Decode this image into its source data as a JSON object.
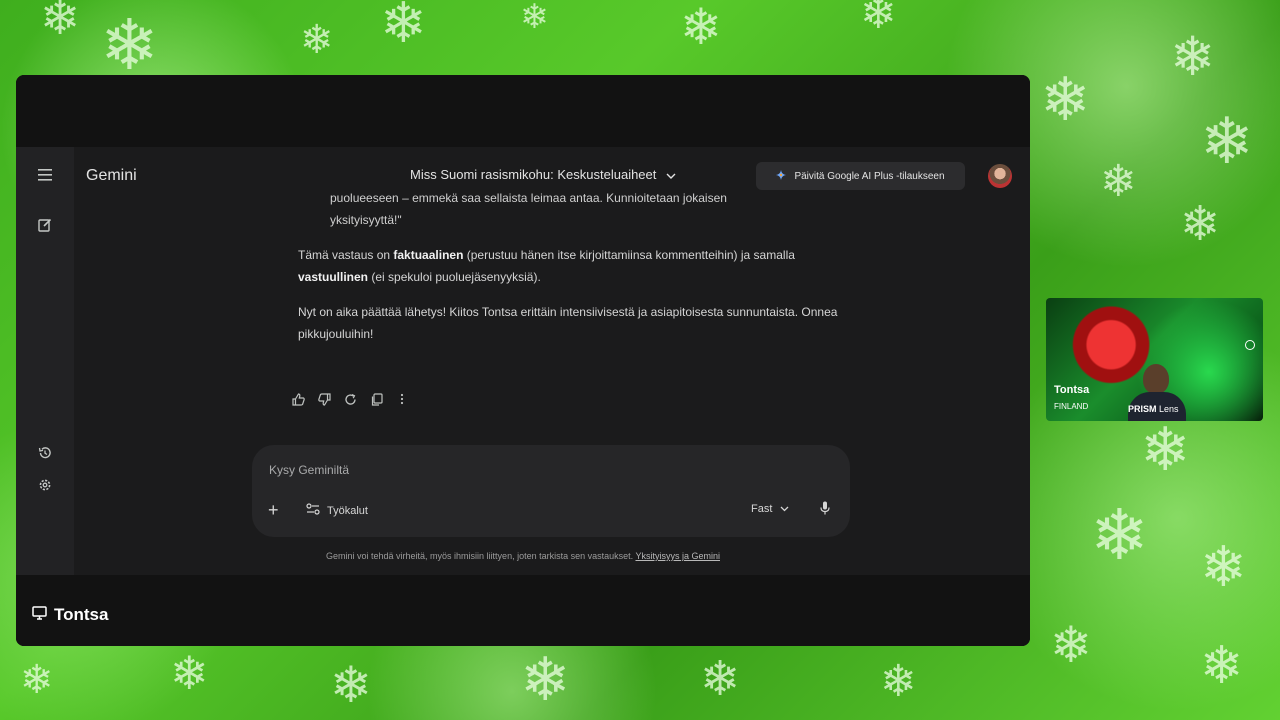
{
  "colors": {
    "background_green": "#4fbf25",
    "window_bg": "#121212",
    "gemini_bg": "#1b1b1c",
    "composer_bg": "#262628",
    "text": "#e3e3e3"
  },
  "gemini": {
    "brand": "Gemini",
    "chat_title": "Miss Suomi rasismikohu: Keskusteluaiheet",
    "upgrade_label": "Päivitä Google AI Plus -tilaukseen",
    "quote_line1": "puolueeseen – emmekä saa sellaista leimaa antaa. Kunnioitetaan jokaisen",
    "quote_line2": "yksityisyyttä!\"",
    "para1": {
      "pre": "Tämä vastaus on ",
      "bold1": "faktuaalinen",
      "mid": " (perustuu hänen itse kirjoittamiinsa kommentteihin) ja samalla",
      "bold2": "vastuullinen",
      "post": " (ei spekuloi puoluejäsenyyksiä)."
    },
    "para2": "Nyt on aika päättää lähetys! Kiitos Tontsa erittäin intensiivisestä ja asiapitoisesta sunnuntaista. Onnea pikkujouluihin!",
    "composer": {
      "placeholder": "Kysy Geminiltä",
      "tools_label": "Työkalut",
      "model_label": "Fast"
    },
    "disclaimer": "Gemini voi tehdä virheitä, myös ihmisiin liittyen, joten tarkista sen vastaukset.",
    "disclaimer_link": "Yksityisyys ja Gemini"
  },
  "presenter": {
    "name": "Tontsa"
  },
  "camera": {
    "name": "Tontsa",
    "location": "FINLAND",
    "lens_brand": "PRISM",
    "lens_suffix": "Lens"
  },
  "icons": [
    "menu-icon",
    "new-chat-icon",
    "activity-icon",
    "settings-icon",
    "thumbs-up-icon",
    "thumbs-down-icon",
    "regenerate-icon",
    "copy-icon",
    "more-icon",
    "plus-icon",
    "tools-icon",
    "chevron-down-icon",
    "mic-icon",
    "screen-share-icon",
    "sparkle-icon"
  ]
}
